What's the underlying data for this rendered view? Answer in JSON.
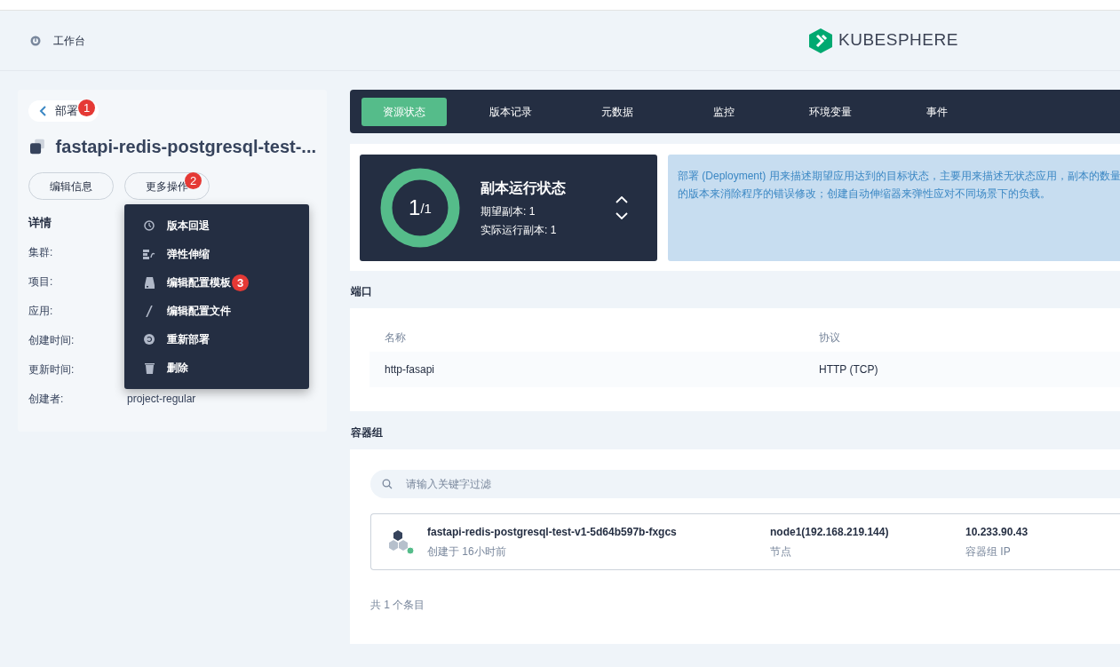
{
  "header": {
    "workbench": "工作台",
    "logo": "KUBESPHERE"
  },
  "left": {
    "back": "部署",
    "back_badge": "1",
    "title": "fastapi-redis-postgresql-test-...",
    "buttons": [
      {
        "label": "编辑信息"
      },
      {
        "label": "更多操作",
        "badge": "2"
      }
    ],
    "details_title": "详情",
    "details": [
      {
        "key": "集群:"
      },
      {
        "key": "项目:"
      },
      {
        "key": "应用:"
      },
      {
        "key": "创建时间:"
      },
      {
        "key": "更新时间:"
      },
      {
        "key": "创建者:",
        "value": "project-regular"
      }
    ],
    "menu": [
      {
        "kind": "history",
        "label": "版本回退"
      },
      {
        "kind": "scale",
        "label": "弹性伸缩"
      },
      {
        "kind": "disk",
        "label": "编辑配置模板",
        "badge": "3"
      },
      {
        "kind": "pen",
        "label": "编辑配置文件"
      },
      {
        "kind": "redeploy",
        "label": "重新部署"
      },
      {
        "kind": "trash",
        "label": "删除"
      }
    ]
  },
  "tabs": [
    {
      "label": "资源状态",
      "selected": true
    },
    {
      "label": "版本记录",
      "selected": false
    },
    {
      "label": "元数据",
      "selected": false
    },
    {
      "label": "监控",
      "selected": false
    },
    {
      "label": "环境变量",
      "selected": false
    },
    {
      "label": "事件",
      "selected": false
    }
  ],
  "replicas": {
    "current": "1",
    "total": "/1",
    "title": "副本运行状态",
    "desired": "期望副本: 1",
    "running": "实际运行副本: 1"
  },
  "description": [
    "部署 (Deployment) 用来描述期望应用达到的目标状态，主要用来描述无状态应用，副本的数量",
    "的版本来消除程序的错误修改；创建自动伸缩器来弹性应对不同场景下的负载。"
  ],
  "ports": {
    "title": "端口",
    "columns": [
      "名称",
      "协议"
    ],
    "rows": [
      [
        "http-fasapi",
        "HTTP (TCP)"
      ]
    ]
  },
  "pods": {
    "title": "容器组",
    "search_placeholder": "请输入关键字过滤",
    "items": [
      {
        "name": "fastapi-redis-postgresql-test-v1-5d64b597b-fxgcs",
        "created": "创建于 16小时前",
        "node": "node1(192.168.219.144)",
        "node_label": "节点",
        "ip": "10.233.90.43",
        "ip_label": "容器组 IP",
        "running": true
      }
    ],
    "total": "共 1 个条目"
  }
}
